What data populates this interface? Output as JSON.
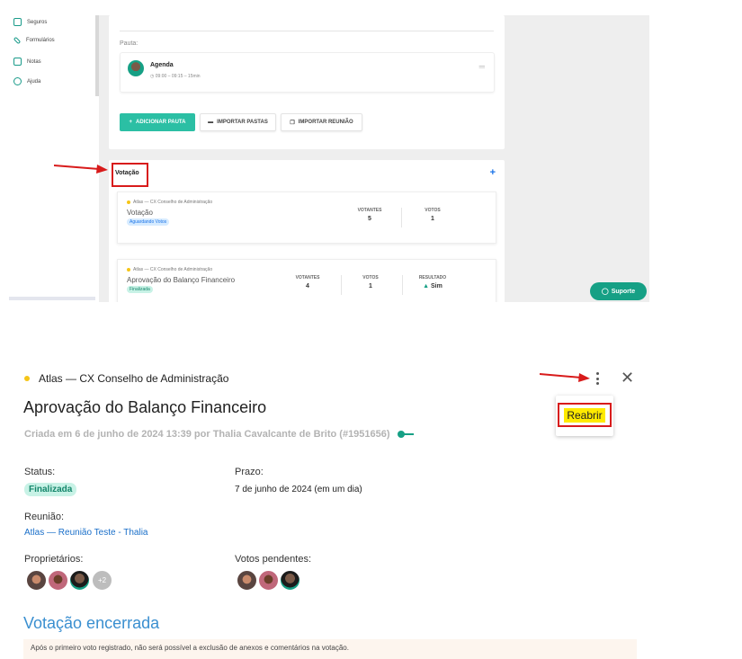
{
  "sidebar": {
    "items": [
      {
        "label": "Seguros",
        "icon": "download-box-icon"
      },
      {
        "label": "Formulários",
        "icon": "pencil-icon"
      },
      {
        "label": "Notas",
        "icon": "note-icon"
      },
      {
        "label": "Ajuda",
        "icon": "help-circle-icon"
      }
    ]
  },
  "pauta": {
    "label": "Pauta:",
    "item": {
      "title": "Agenda",
      "time": "09:00 – 09:15 – 15min"
    },
    "buttons": {
      "add": "ADICIONAR PAUTA",
      "import_folders": "IMPORTAR PASTAS",
      "import_meeting": "IMPORTAR REUNIÃO"
    }
  },
  "votacao": {
    "heading": "Votação",
    "add": "+",
    "cards": [
      {
        "org": "Atlas — CX Conselho de Administração",
        "title": "Votação",
        "status": "Aguardando Votos",
        "votantes_label": "VOTANTES",
        "votantes": "5",
        "votos_label": "VOTOS",
        "votos": "1"
      },
      {
        "org": "Atlas — CX Conselho de Administração",
        "title": "Aprovação do Balanço Financeiro",
        "status": "Finalizada",
        "votantes_label": "VOTANTES",
        "votantes": "4",
        "votos_label": "VOTOS",
        "votos": "1",
        "resultado_label": "RESULTADO",
        "resultado": "Sim"
      }
    ]
  },
  "suporte": "Suporte",
  "detail": {
    "org": "Atlas — CX Conselho de Administração",
    "menu": {
      "reabrir": "Reabrir"
    },
    "close": "✕",
    "title": "Aprovação do Balanço Financeiro",
    "created": "Criada em 6 de junho de 2024 13:39 por Thalia Cavalcante de Brito (#1951656)",
    "status_label": "Status:",
    "status": "Finalizada",
    "prazo_label": "Prazo:",
    "prazo": "7 de junho de 2024 (em um dia)",
    "reuniao_label": "Reunião:",
    "reuniao": "Atlas — Reunião Teste - Thalia",
    "proprietarios_label": "Proprietários:",
    "proprietarios_more": "+2",
    "votos_pendentes_label": "Votos pendentes:",
    "encerrada": "Votação encerrada",
    "notice": "Após o primeiro voto registrado, não será possível a exclusão de anexos e comentários na votação."
  },
  "colors": {
    "accent": "#16a085",
    "annotation": "#d81b1b",
    "highlight": "#ffea00",
    "link": "#1a6fc9"
  }
}
